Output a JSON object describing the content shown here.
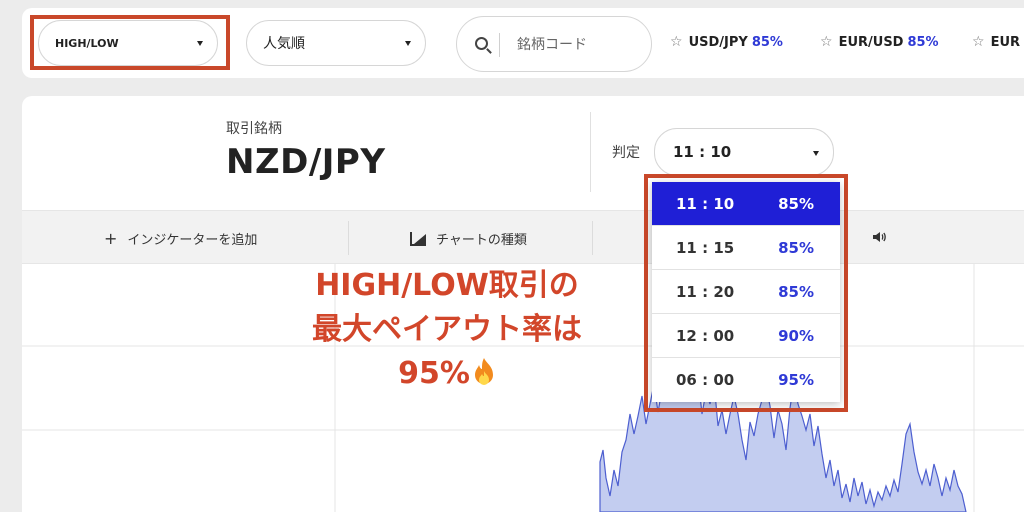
{
  "header": {
    "trade_type": "HIGH/LOW",
    "sort": "人気順",
    "search_placeholder": "銘柄コード",
    "favorites": [
      {
        "pair": "USD/JPY",
        "payout": "85%"
      },
      {
        "pair": "EUR/USD",
        "payout": "85%"
      },
      {
        "pair": "EUR",
        "payout": ""
      }
    ]
  },
  "asset": {
    "label": "取引銘柄",
    "name": "NZD/JPY"
  },
  "expiry": {
    "label": "判定",
    "selected": "11 : 10",
    "options": [
      {
        "time": "11 : 10",
        "payout": "85%",
        "active": true
      },
      {
        "time": "11 : 15",
        "payout": "85%",
        "active": false
      },
      {
        "time": "11 : 20",
        "payout": "85%",
        "active": false
      },
      {
        "time": "12 : 00",
        "payout": "90%",
        "active": false
      },
      {
        "time": "06 : 00",
        "payout": "95%",
        "active": false
      }
    ]
  },
  "toolbar": {
    "add_indicator": "インジケーターを追加",
    "chart_type": "チャートの種類"
  },
  "promo": {
    "line1": "HIGH/LOW取引の",
    "line2": "最大ペイアウト率は",
    "line3": "95%"
  },
  "colors": {
    "accent": "#2f3ad6",
    "highlight": "#c9482a",
    "chart_fill": "#c3cdf0",
    "chart_line": "#4d5fd0"
  },
  "icons": {
    "search": "search-icon",
    "star": "star-icon",
    "speaker": "speaker-icon",
    "fire": "fire-icon"
  }
}
